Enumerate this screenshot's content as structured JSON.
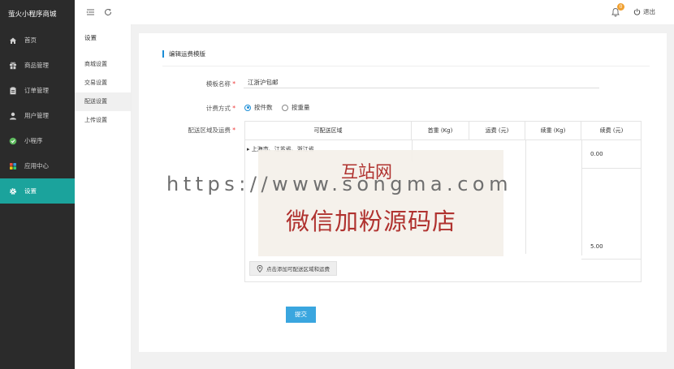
{
  "app": {
    "title": "萤火小程序商城"
  },
  "sidebar": {
    "items": [
      {
        "label": "首页",
        "icon": "home-icon"
      },
      {
        "label": "商品管理",
        "icon": "gift-icon"
      },
      {
        "label": "订单管理",
        "icon": "clipboard-icon"
      },
      {
        "label": "用户管理",
        "icon": "user-icon"
      },
      {
        "label": "小程序",
        "icon": "wechat-icon"
      },
      {
        "label": "应用中心",
        "icon": "apps-icon"
      },
      {
        "label": "设置",
        "icon": "gear-icon",
        "active": true
      }
    ],
    "active_color": "#1ba39c"
  },
  "header": {
    "notification_count": "0",
    "logout_label": "退出"
  },
  "subnav": {
    "title": "设置",
    "items": [
      {
        "label": "商城设置"
      },
      {
        "label": "交易设置"
      },
      {
        "label": "配送设置",
        "active": true
      },
      {
        "label": "上传设置"
      }
    ]
  },
  "form": {
    "title": "编辑运费模版",
    "name_label": "模板名称",
    "name_value": "江浙沪包邮",
    "method_label": "计费方式",
    "method_options": [
      {
        "label": "按件数",
        "selected": true
      },
      {
        "label": "按重量",
        "selected": false
      }
    ],
    "region_label": "配送区域及运费",
    "table": {
      "headers": [
        "可配送区域",
        "首重 (Kg)",
        "运费 (元)",
        "续重 (Kg)",
        "续费 (元)"
      ],
      "row1_region": "上海市、江苏省、浙江省",
      "row1_additional_fee": "0.00",
      "row2_additional_fee": "5.00"
    },
    "add_region_label": "点击添加可配送区域和运费",
    "submit_label": "提交"
  },
  "watermark": {
    "url": "https://www.songma.com",
    "title": "互站网",
    "shop": "微信加粉源码店"
  },
  "colors": {
    "accent": "#1b8dd6",
    "submit": "#3aa6df",
    "required": "#e33333"
  }
}
